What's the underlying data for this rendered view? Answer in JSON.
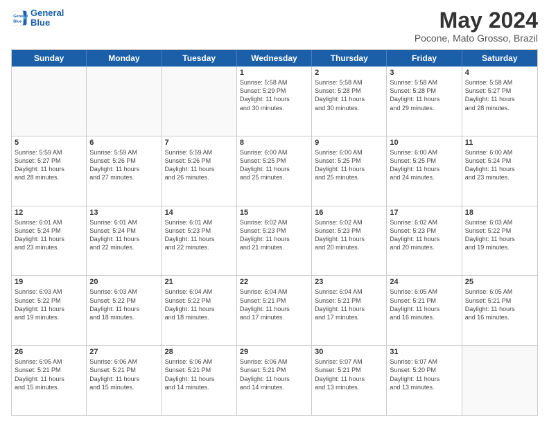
{
  "header": {
    "logo_line1": "General",
    "logo_line2": "Blue",
    "month": "May 2024",
    "location": "Pocone, Mato Grosso, Brazil"
  },
  "weekdays": [
    "Sunday",
    "Monday",
    "Tuesday",
    "Wednesday",
    "Thursday",
    "Friday",
    "Saturday"
  ],
  "weeks": [
    [
      {
        "day": "",
        "info": []
      },
      {
        "day": "",
        "info": []
      },
      {
        "day": "",
        "info": []
      },
      {
        "day": "1",
        "info": [
          "Sunrise: 5:58 AM",
          "Sunset: 5:29 PM",
          "Daylight: 11 hours",
          "and 30 minutes."
        ]
      },
      {
        "day": "2",
        "info": [
          "Sunrise: 5:58 AM",
          "Sunset: 5:28 PM",
          "Daylight: 11 hours",
          "and 30 minutes."
        ]
      },
      {
        "day": "3",
        "info": [
          "Sunrise: 5:58 AM",
          "Sunset: 5:28 PM",
          "Daylight: 11 hours",
          "and 29 minutes."
        ]
      },
      {
        "day": "4",
        "info": [
          "Sunrise: 5:58 AM",
          "Sunset: 5:27 PM",
          "Daylight: 11 hours",
          "and 28 minutes."
        ]
      }
    ],
    [
      {
        "day": "5",
        "info": [
          "Sunrise: 5:59 AM",
          "Sunset: 5:27 PM",
          "Daylight: 11 hours",
          "and 28 minutes."
        ]
      },
      {
        "day": "6",
        "info": [
          "Sunrise: 5:59 AM",
          "Sunset: 5:26 PM",
          "Daylight: 11 hours",
          "and 27 minutes."
        ]
      },
      {
        "day": "7",
        "info": [
          "Sunrise: 5:59 AM",
          "Sunset: 5:26 PM",
          "Daylight: 11 hours",
          "and 26 minutes."
        ]
      },
      {
        "day": "8",
        "info": [
          "Sunrise: 6:00 AM",
          "Sunset: 5:25 PM",
          "Daylight: 11 hours",
          "and 25 minutes."
        ]
      },
      {
        "day": "9",
        "info": [
          "Sunrise: 6:00 AM",
          "Sunset: 5:25 PM",
          "Daylight: 11 hours",
          "and 25 minutes."
        ]
      },
      {
        "day": "10",
        "info": [
          "Sunrise: 6:00 AM",
          "Sunset: 5:25 PM",
          "Daylight: 11 hours",
          "and 24 minutes."
        ]
      },
      {
        "day": "11",
        "info": [
          "Sunrise: 6:00 AM",
          "Sunset: 5:24 PM",
          "Daylight: 11 hours",
          "and 23 minutes."
        ]
      }
    ],
    [
      {
        "day": "12",
        "info": [
          "Sunrise: 6:01 AM",
          "Sunset: 5:24 PM",
          "Daylight: 11 hours",
          "and 23 minutes."
        ]
      },
      {
        "day": "13",
        "info": [
          "Sunrise: 6:01 AM",
          "Sunset: 5:24 PM",
          "Daylight: 11 hours",
          "and 22 minutes."
        ]
      },
      {
        "day": "14",
        "info": [
          "Sunrise: 6:01 AM",
          "Sunset: 5:23 PM",
          "Daylight: 11 hours",
          "and 22 minutes."
        ]
      },
      {
        "day": "15",
        "info": [
          "Sunrise: 6:02 AM",
          "Sunset: 5:23 PM",
          "Daylight: 11 hours",
          "and 21 minutes."
        ]
      },
      {
        "day": "16",
        "info": [
          "Sunrise: 6:02 AM",
          "Sunset: 5:23 PM",
          "Daylight: 11 hours",
          "and 20 minutes."
        ]
      },
      {
        "day": "17",
        "info": [
          "Sunrise: 6:02 AM",
          "Sunset: 5:23 PM",
          "Daylight: 11 hours",
          "and 20 minutes."
        ]
      },
      {
        "day": "18",
        "info": [
          "Sunrise: 6:03 AM",
          "Sunset: 5:22 PM",
          "Daylight: 11 hours",
          "and 19 minutes."
        ]
      }
    ],
    [
      {
        "day": "19",
        "info": [
          "Sunrise: 6:03 AM",
          "Sunset: 5:22 PM",
          "Daylight: 11 hours",
          "and 19 minutes."
        ]
      },
      {
        "day": "20",
        "info": [
          "Sunrise: 6:03 AM",
          "Sunset: 5:22 PM",
          "Daylight: 11 hours",
          "and 18 minutes."
        ]
      },
      {
        "day": "21",
        "info": [
          "Sunrise: 6:04 AM",
          "Sunset: 5:22 PM",
          "Daylight: 11 hours",
          "and 18 minutes."
        ]
      },
      {
        "day": "22",
        "info": [
          "Sunrise: 6:04 AM",
          "Sunset: 5:21 PM",
          "Daylight: 11 hours",
          "and 17 minutes."
        ]
      },
      {
        "day": "23",
        "info": [
          "Sunrise: 6:04 AM",
          "Sunset: 5:21 PM",
          "Daylight: 11 hours",
          "and 17 minutes."
        ]
      },
      {
        "day": "24",
        "info": [
          "Sunrise: 6:05 AM",
          "Sunset: 5:21 PM",
          "Daylight: 11 hours",
          "and 16 minutes."
        ]
      },
      {
        "day": "25",
        "info": [
          "Sunrise: 6:05 AM",
          "Sunset: 5:21 PM",
          "Daylight: 11 hours",
          "and 16 minutes."
        ]
      }
    ],
    [
      {
        "day": "26",
        "info": [
          "Sunrise: 6:05 AM",
          "Sunset: 5:21 PM",
          "Daylight: 11 hours",
          "and 15 minutes."
        ]
      },
      {
        "day": "27",
        "info": [
          "Sunrise: 6:06 AM",
          "Sunset: 5:21 PM",
          "Daylight: 11 hours",
          "and 15 minutes."
        ]
      },
      {
        "day": "28",
        "info": [
          "Sunrise: 6:06 AM",
          "Sunset: 5:21 PM",
          "Daylight: 11 hours",
          "and 14 minutes."
        ]
      },
      {
        "day": "29",
        "info": [
          "Sunrise: 6:06 AM",
          "Sunset: 5:21 PM",
          "Daylight: 11 hours",
          "and 14 minutes."
        ]
      },
      {
        "day": "30",
        "info": [
          "Sunrise: 6:07 AM",
          "Sunset: 5:21 PM",
          "Daylight: 11 hours",
          "and 13 minutes."
        ]
      },
      {
        "day": "31",
        "info": [
          "Sunrise: 6:07 AM",
          "Sunset: 5:20 PM",
          "Daylight: 11 hours",
          "and 13 minutes."
        ]
      },
      {
        "day": "",
        "info": []
      }
    ]
  ]
}
